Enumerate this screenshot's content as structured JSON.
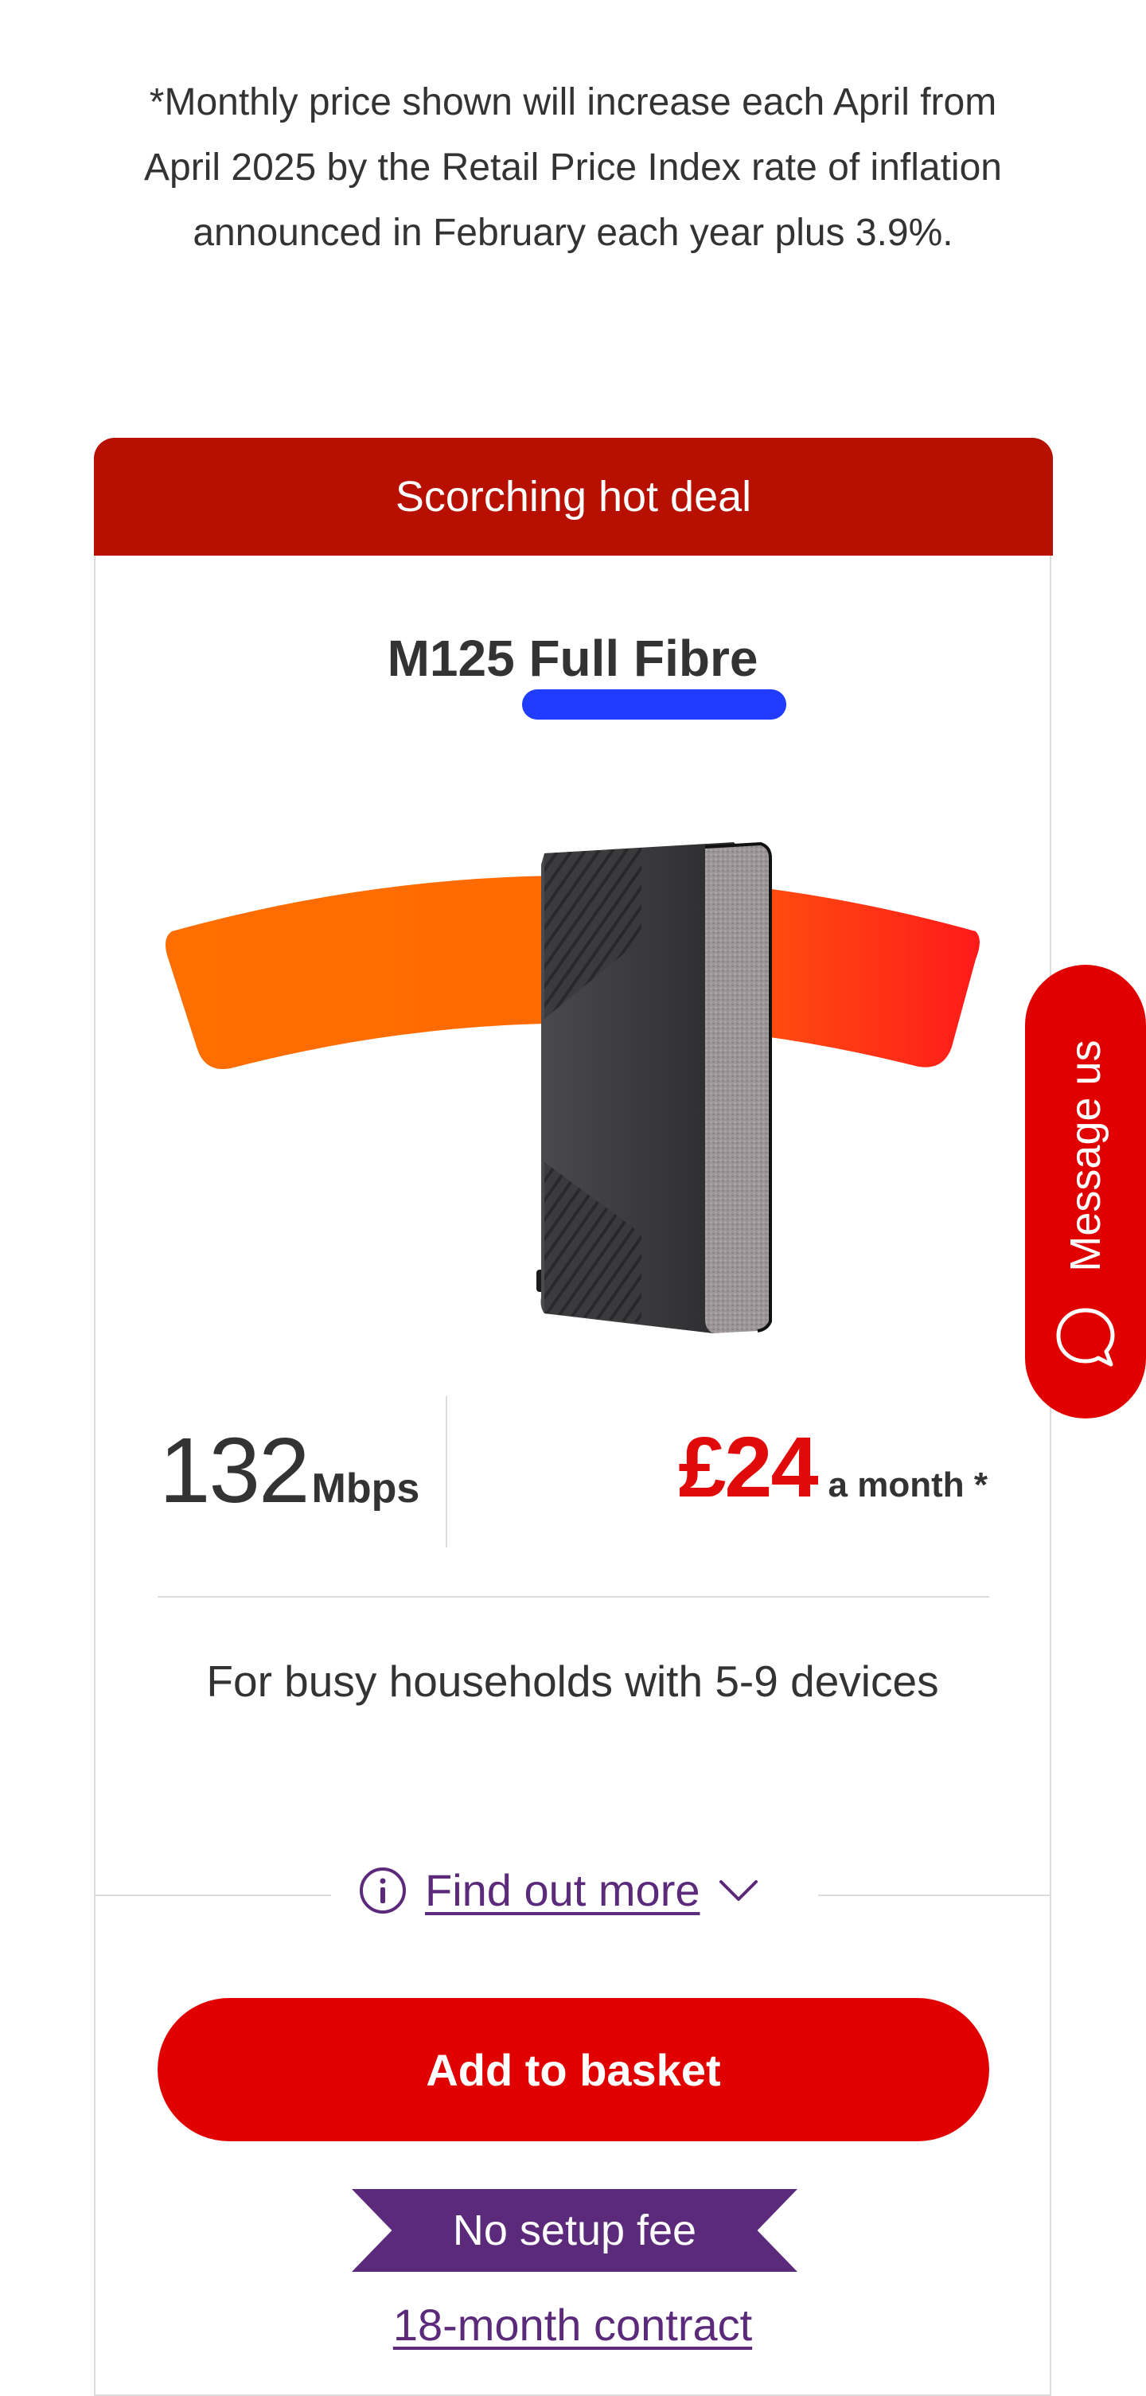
{
  "disclaimer": "*Monthly price shown will increase each April from April 2025 by the Retail Price Index rate of inflation announced in February each year plus 3.9%.",
  "deal": {
    "banner": "Scorching hot deal",
    "title": "M125 Full Fibre",
    "speed_value": "132",
    "speed_unit": "Mbps",
    "price_amount": "£24",
    "price_suffix": "a month *",
    "households": "For busy households with 5-9 devices",
    "find_out_more": "Find out more",
    "add_to_basket": "Add to basket",
    "setup_fee_badge": "No setup fee",
    "contract_link": "18-month contract"
  },
  "message_tab": {
    "label": "Message us"
  },
  "icons": {
    "info": "info-circle-icon",
    "chevron": "chevron-down-icon",
    "chat": "chat-bubble-icon",
    "router": "router-image"
  },
  "colors": {
    "banner": "#b70f00",
    "price": "#e10a0a",
    "cta": "#e10000",
    "link": "#5b2a7a",
    "ribbon": "#5b2a7a"
  }
}
